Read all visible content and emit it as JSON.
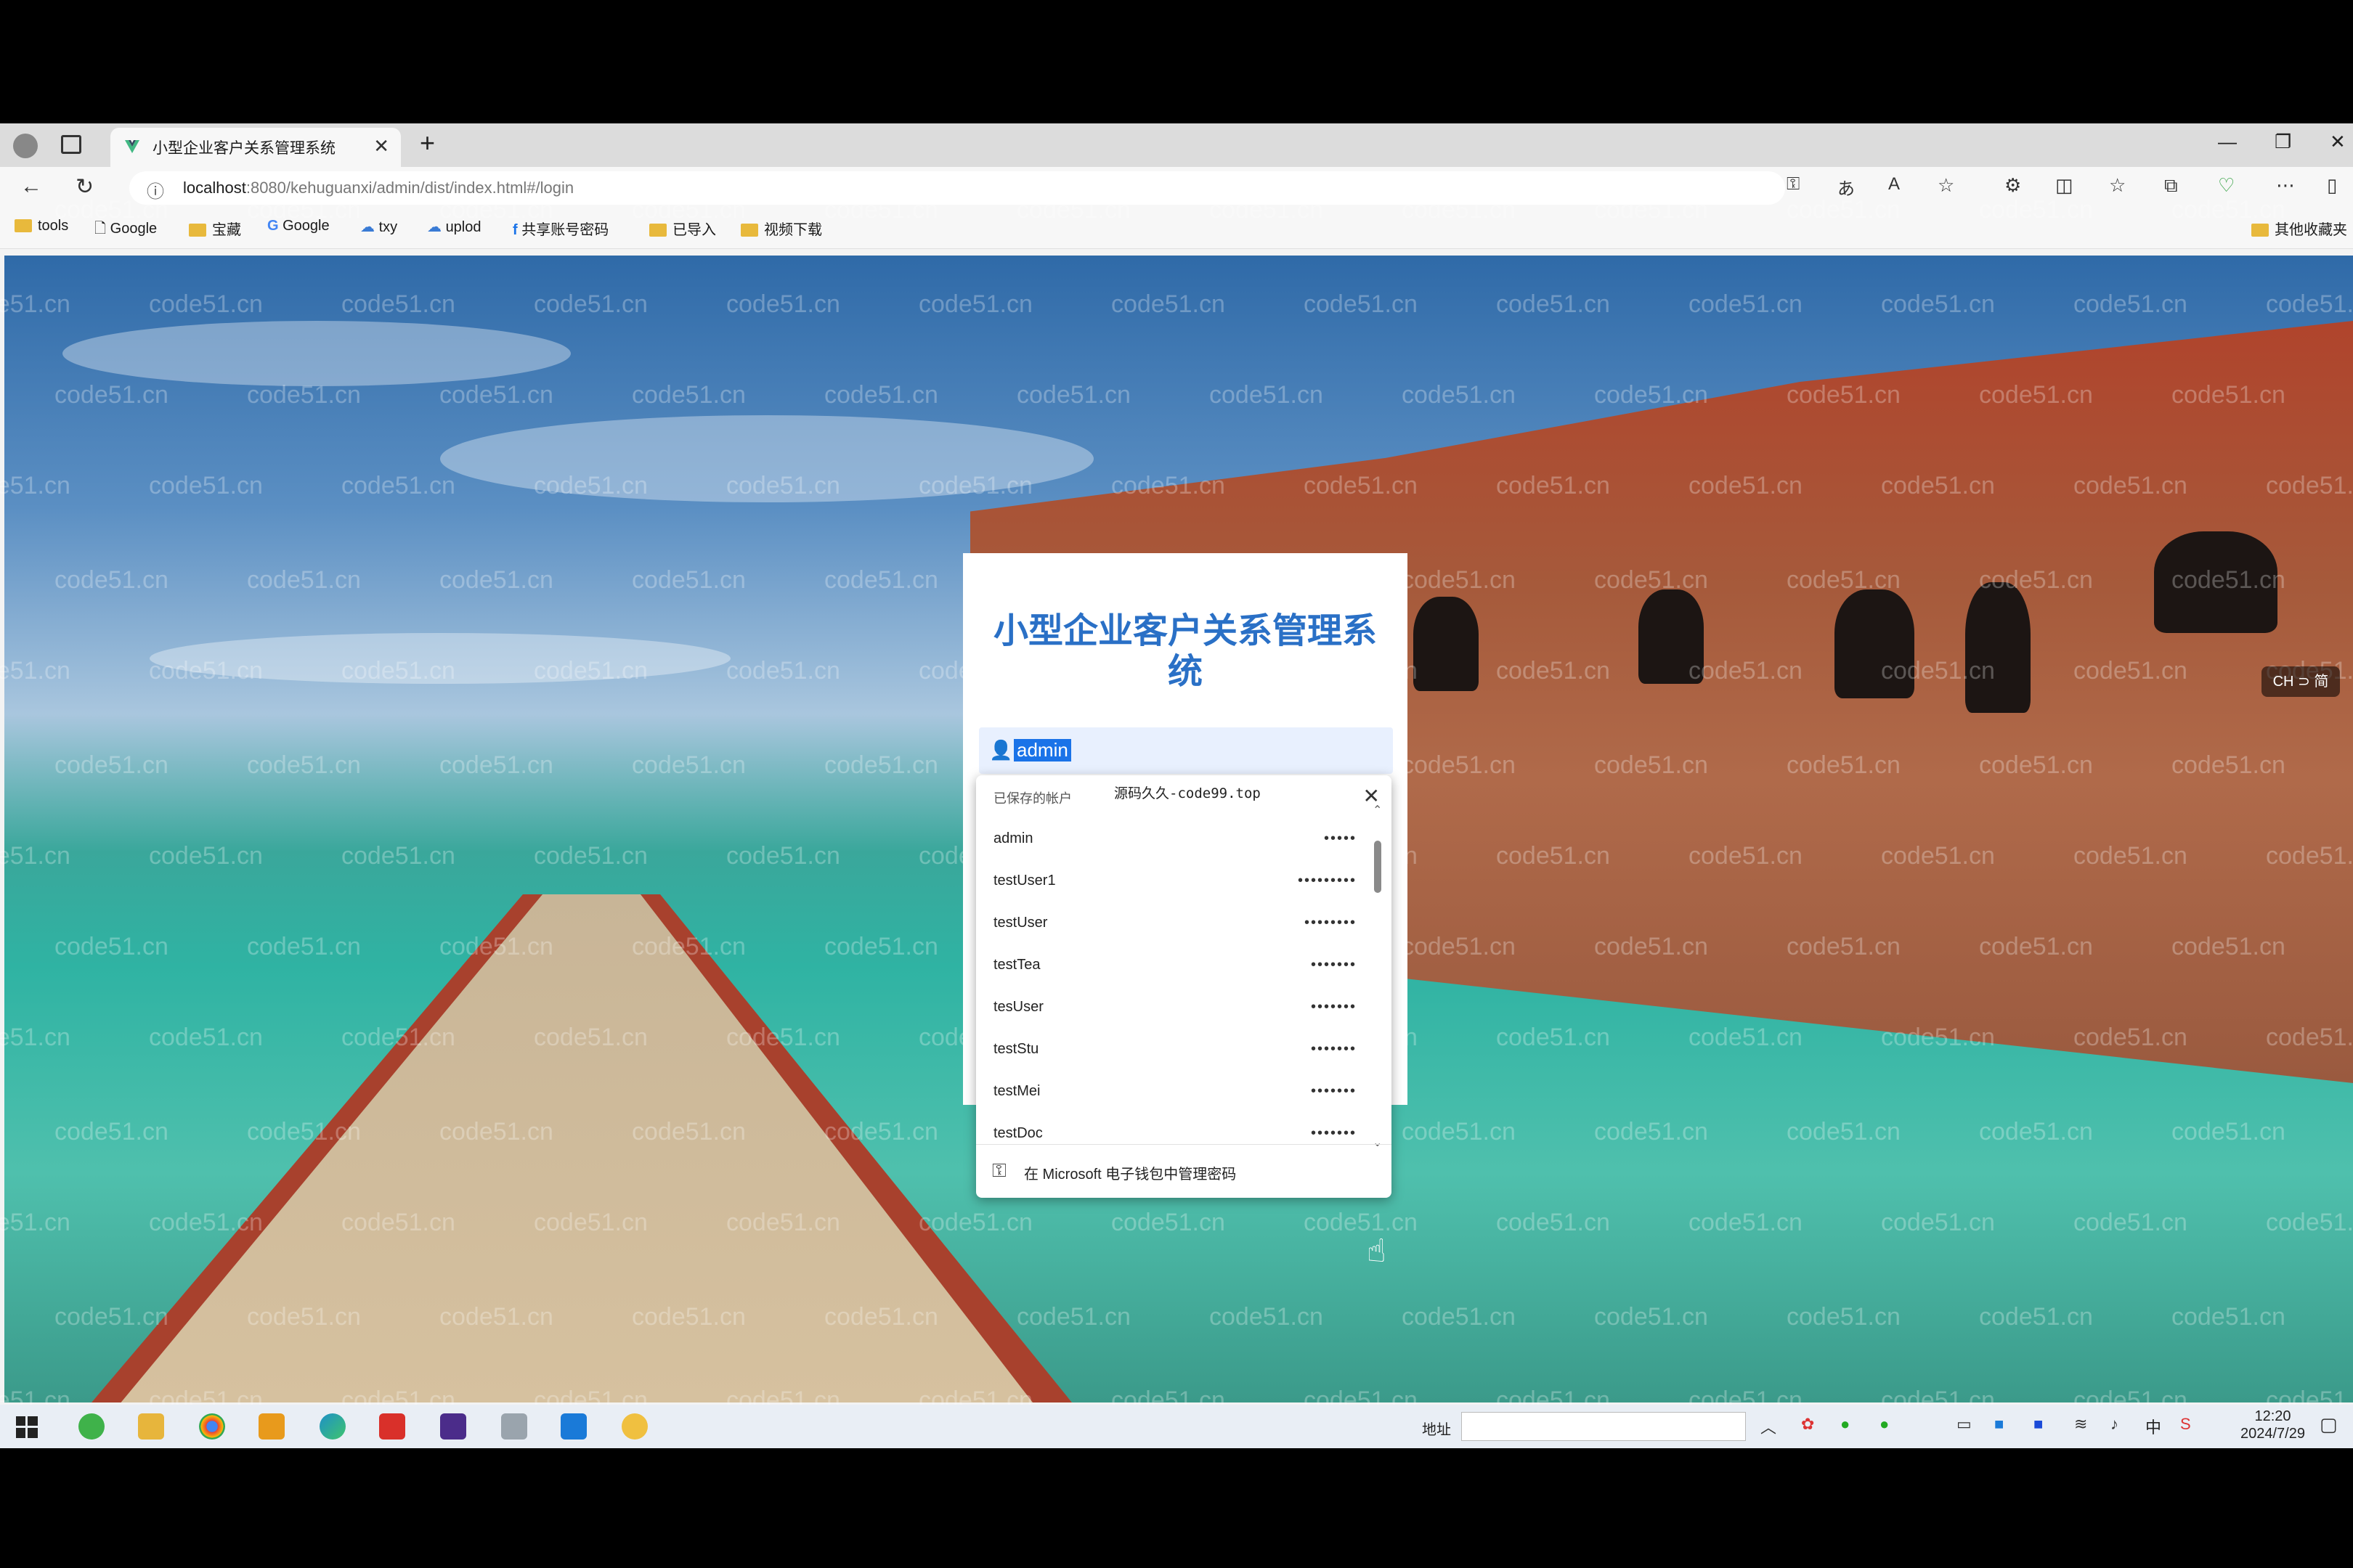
{
  "browser": {
    "tab_title": "小型企业客户关系管理系统",
    "new_tab": "+",
    "url_host": "localhost",
    "url_rest": ":8080/kehuguanxi/admin/dist/index.html#/login",
    "window_controls": {
      "minimize": "—",
      "restore": "❐",
      "close": "✕"
    }
  },
  "bookmarks": {
    "items": [
      "tools",
      "Google",
      "宝藏",
      "Google",
      "txy",
      "uplod",
      "共享账号密码",
      "已导入",
      "视频下载"
    ],
    "other": "其他收藏夹"
  },
  "watermark": "code51.cn",
  "login": {
    "title": "小型企业客户关系管理系统",
    "username_value": "admin"
  },
  "saved_accounts": {
    "header": "已保存的帐户",
    "brand": "源码久久-code99.top",
    "accounts": [
      {
        "name": "admin",
        "masked": "•••••"
      },
      {
        "name": "testUser1",
        "masked": "•••••••••"
      },
      {
        "name": "testUser",
        "masked": "••••••••"
      },
      {
        "name": "testTea",
        "masked": "•••••••"
      },
      {
        "name": "tesUser",
        "masked": "•••••••"
      },
      {
        "name": "testStu",
        "masked": "•••••••"
      },
      {
        "name": "testMei",
        "masked": "•••••••"
      },
      {
        "name": "testDoc",
        "masked": "•••••••"
      }
    ],
    "footer": "在 Microsoft 电子钱包中管理密码"
  },
  "lang_badge": "CH ⊃ 简",
  "taskbar": {
    "address_label": "地址",
    "time": "12:20",
    "date": "2024/7/29",
    "ime": "中"
  }
}
